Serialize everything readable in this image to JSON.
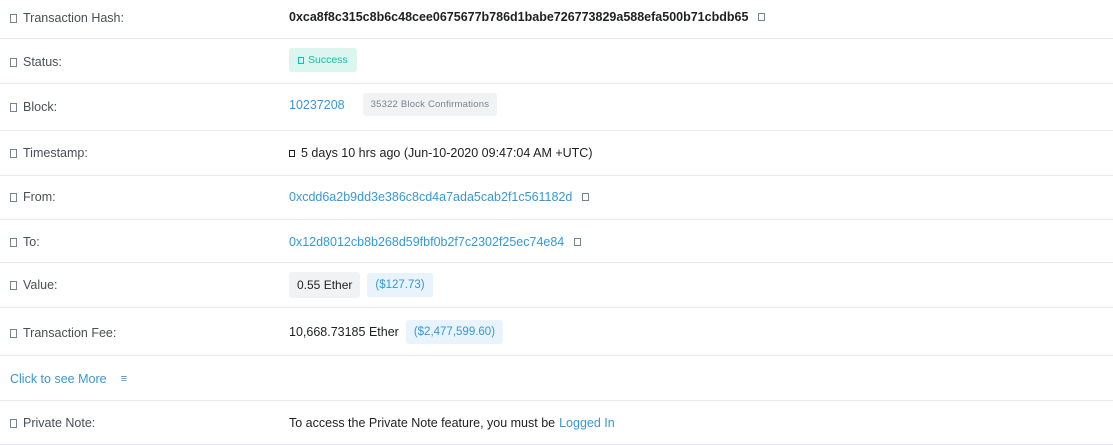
{
  "rows": {
    "tx_hash": {
      "label": "Transaction Hash:",
      "value": "0xca8f8c315c8b6c48cee0675677b786d1babe726773829a588efa500b71cbdb65"
    },
    "status": {
      "label": "Status:",
      "value": "Success"
    },
    "block": {
      "label": "Block:",
      "number": "10237208",
      "confirmations": "35322 Block Confirmations"
    },
    "timestamp": {
      "label": "Timestamp:",
      "value": "5 days 10 hrs ago (Jun-10-2020 09:47:04 AM +UTC)"
    },
    "from": {
      "label": "From:",
      "value": "0xcdd6a2b9dd3e386c8cd4a7ada5cab2f1c561182d"
    },
    "to": {
      "label": "To:",
      "value": "0x12d8012cb8b268d59fbf0b2f7c2302f25ec74e84"
    },
    "value": {
      "label": "Value:",
      "amount": "0.55 Ether",
      "usd": "($127.73)"
    },
    "fee": {
      "label": "Transaction Fee:",
      "amount": "10,668.73185 Ether",
      "usd": "($2,477,599.60)"
    },
    "more": {
      "label": "Click to see More",
      "icon": "≡"
    },
    "private_note": {
      "label": "Private Note:",
      "text": "To access the Private Note feature, you must be",
      "link": "Logged In"
    }
  },
  "colors": {
    "link": "#3498db",
    "success": "#00c9a7",
    "success_bg": "#dcf5ef",
    "divider": "#e7eaf3"
  },
  "icons": {
    "label_help": "question-circle-icon",
    "copy": "copy-icon",
    "status": "check-circle-icon",
    "timestamp": "clock-icon"
  }
}
